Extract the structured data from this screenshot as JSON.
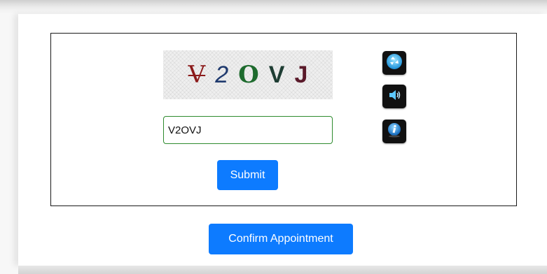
{
  "captcha": {
    "characters": [
      "V",
      "2",
      "O",
      "V",
      "J"
    ],
    "input_value": "V2OVJ",
    "submit_label": "Submit",
    "icons": {
      "refresh": "refresh-icon",
      "audio": "speaker-icon",
      "info": "info-icon"
    }
  },
  "footer": {
    "confirm_label": "Confirm Appointment"
  },
  "colors": {
    "primary_button": "#0d7bff",
    "input_border": "#2e8b2e"
  }
}
